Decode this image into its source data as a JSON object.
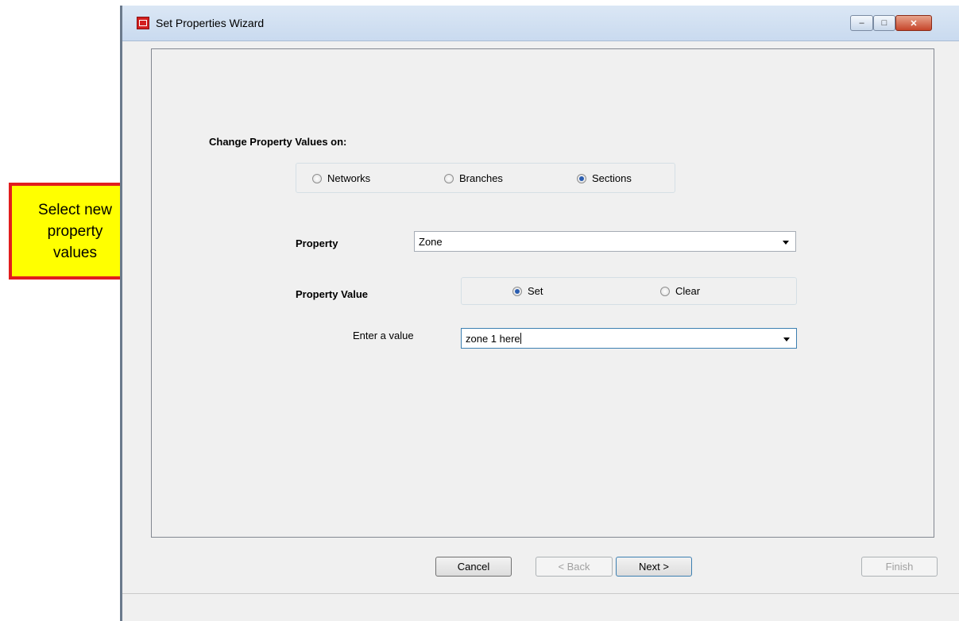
{
  "window": {
    "title": "Set Properties Wizard",
    "controls": {
      "minimize": "–",
      "maximize": "□",
      "close": "✕"
    }
  },
  "form": {
    "change_on_label": "Change Property Values on:",
    "targets": [
      {
        "label": "Networks",
        "checked": false
      },
      {
        "label": "Branches",
        "checked": false
      },
      {
        "label": "Sections",
        "checked": true
      }
    ],
    "property_label": "Property",
    "property_value_selected": "Zone",
    "property_value_label": "Property Value",
    "value_modes": [
      {
        "label": "Set",
        "checked": true
      },
      {
        "label": "Clear",
        "checked": false
      }
    ],
    "enter_value_label": "Enter a value",
    "enter_value_text": "zone 1 here"
  },
  "buttons": {
    "cancel": "Cancel",
    "back": "< Back",
    "next": "Next >",
    "finish": "Finish"
  },
  "callout": {
    "text_lines": [
      "Select new",
      "property",
      "values"
    ],
    "fill_color": "#ffff00",
    "border_color": "#e11d1d"
  }
}
